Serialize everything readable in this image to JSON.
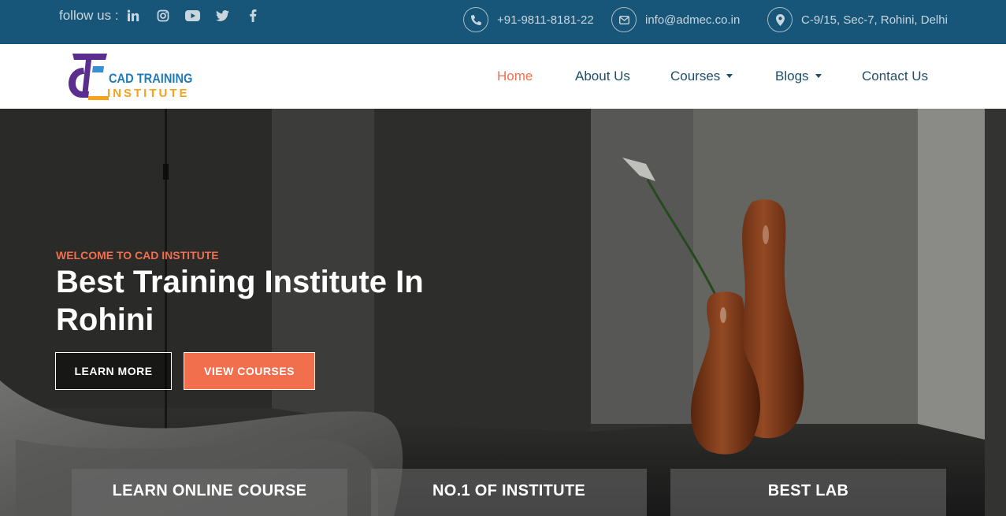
{
  "topbar": {
    "follow_label": "follow us :",
    "social_icons": [
      "linkedin-icon",
      "instagram-icon",
      "youtube-icon",
      "twitter-icon",
      "facebook-icon"
    ],
    "phone": "+91-9811-8181-22",
    "email": "info@admec.co.in",
    "address": "C-9/15, Sec-7, Rohini, Delhi"
  },
  "brand": {
    "line1": "CAD TRAINING",
    "line2": "INSTITUTE"
  },
  "nav": {
    "items": [
      {
        "label": "Home",
        "active": true
      },
      {
        "label": "About Us"
      },
      {
        "label": "Courses",
        "dropdown": true
      },
      {
        "label": "Blogs",
        "dropdown": true
      },
      {
        "label": "Contact Us"
      }
    ]
  },
  "hero": {
    "welcome": "WELCOME TO CAD INSTITUTE",
    "headline": "Best Training Institute In Rohini",
    "learn_more": "LEARN MORE",
    "view_courses": "VIEW COURSES"
  },
  "features": [
    "LEARN ONLINE COURSE",
    "NO.1 OF INSTITUTE",
    "BEST LAB"
  ],
  "colors": {
    "topbar": "#175678",
    "accent": "#f26f4e",
    "nav_text": "#1d4d6a"
  }
}
